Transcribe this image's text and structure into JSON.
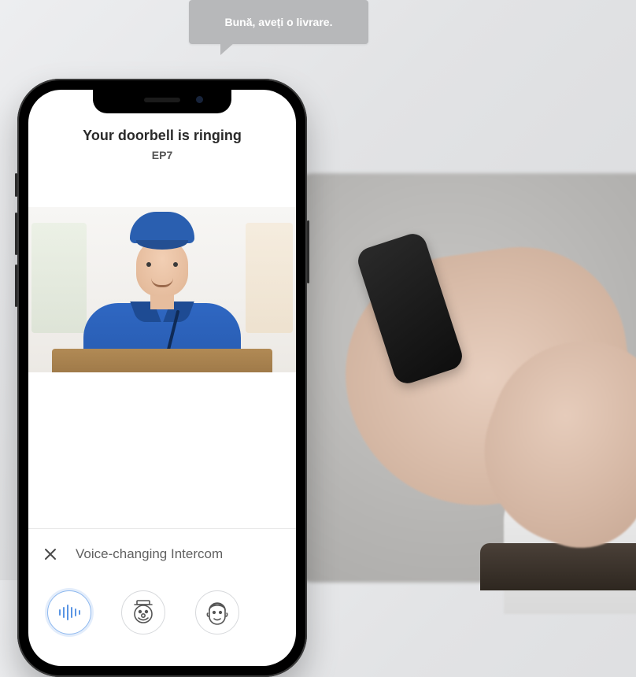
{
  "speech_bubble": {
    "text": "Bună, aveți o livrare."
  },
  "doorbell": {
    "title": "Your doorbell is ringing",
    "device_name": "EP7"
  },
  "intercom_panel": {
    "title": "Voice-changing Intercom",
    "options": [
      {
        "id": "original-voice",
        "selected": true
      },
      {
        "id": "clown-voice",
        "selected": false
      },
      {
        "id": "man-voice",
        "selected": false
      }
    ]
  }
}
